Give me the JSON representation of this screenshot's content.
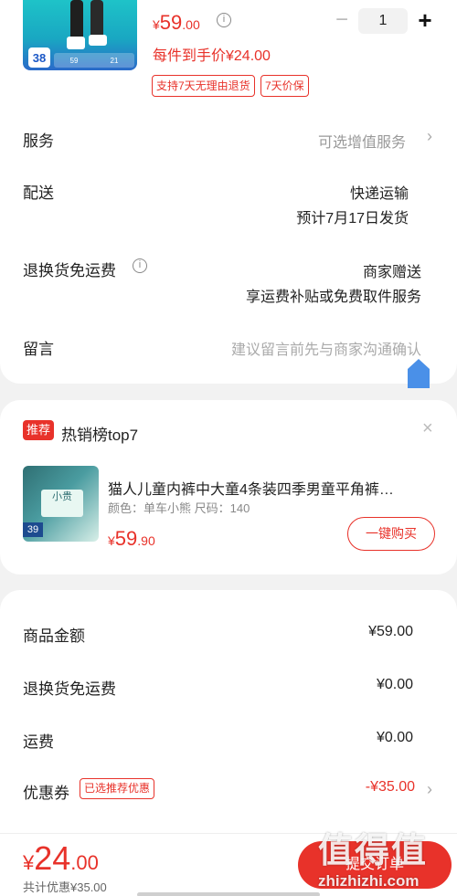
{
  "product": {
    "price_symbol": "¥",
    "price_int": "59",
    "price_dec": ".00",
    "info_icon": "i",
    "hand_price": "每件到手价¥24.00",
    "tags": [
      "支持7天无理由退货",
      "7天价保"
    ],
    "image_badge": "38",
    "image_strip": [
      "59",
      "21"
    ],
    "qty_minus": "−",
    "qty": "1",
    "qty_plus": "+"
  },
  "rows": {
    "service": {
      "label": "服务",
      "value": "可选增值服务",
      "chevron": "›"
    },
    "delivery": {
      "label": "配送",
      "value": "快递运输",
      "sub": "预计7月17日发货"
    },
    "return_ship": {
      "label": "退换货免运费",
      "info_icon": "i",
      "value": "商家赠送",
      "sub": "享运费补贴或免费取件服务"
    },
    "message": {
      "label": "留言",
      "placeholder": "建议留言前先与商家沟通确认"
    }
  },
  "recommend": {
    "badge": "推荐",
    "title": "热销榜top7",
    "close": "×",
    "image_text": "小贵",
    "image_badge": "39",
    "name": "猫人儿童内裤中大童4条装四季男童平角裤…",
    "spec": "颜色：单车小熊   尺码：140",
    "price_symbol": "¥",
    "price_int": "59",
    "price_dec": ".90",
    "buy_label": "一键购买"
  },
  "summary": {
    "goods_amount": {
      "label": "商品金额",
      "value": "¥59.00"
    },
    "return_ship": {
      "label": "退换货免运费",
      "value": "¥0.00"
    },
    "shipping": {
      "label": "运费",
      "value": "¥0.00"
    },
    "coupon": {
      "label": "优惠券",
      "tag": "已选推荐优惠",
      "value": "-¥35.00",
      "chevron": "›"
    }
  },
  "bottom": {
    "total_symbol": "¥",
    "total_int": "24",
    "total_dec": ".00",
    "saved": "共计优惠¥35.00",
    "submit": "提交订单"
  },
  "watermark": {
    "line1": "值得值",
    "line2": "zhizhizhi.com"
  },
  "colors": {
    "accent": "#e8322a",
    "home_icon": "#4a90e8"
  }
}
